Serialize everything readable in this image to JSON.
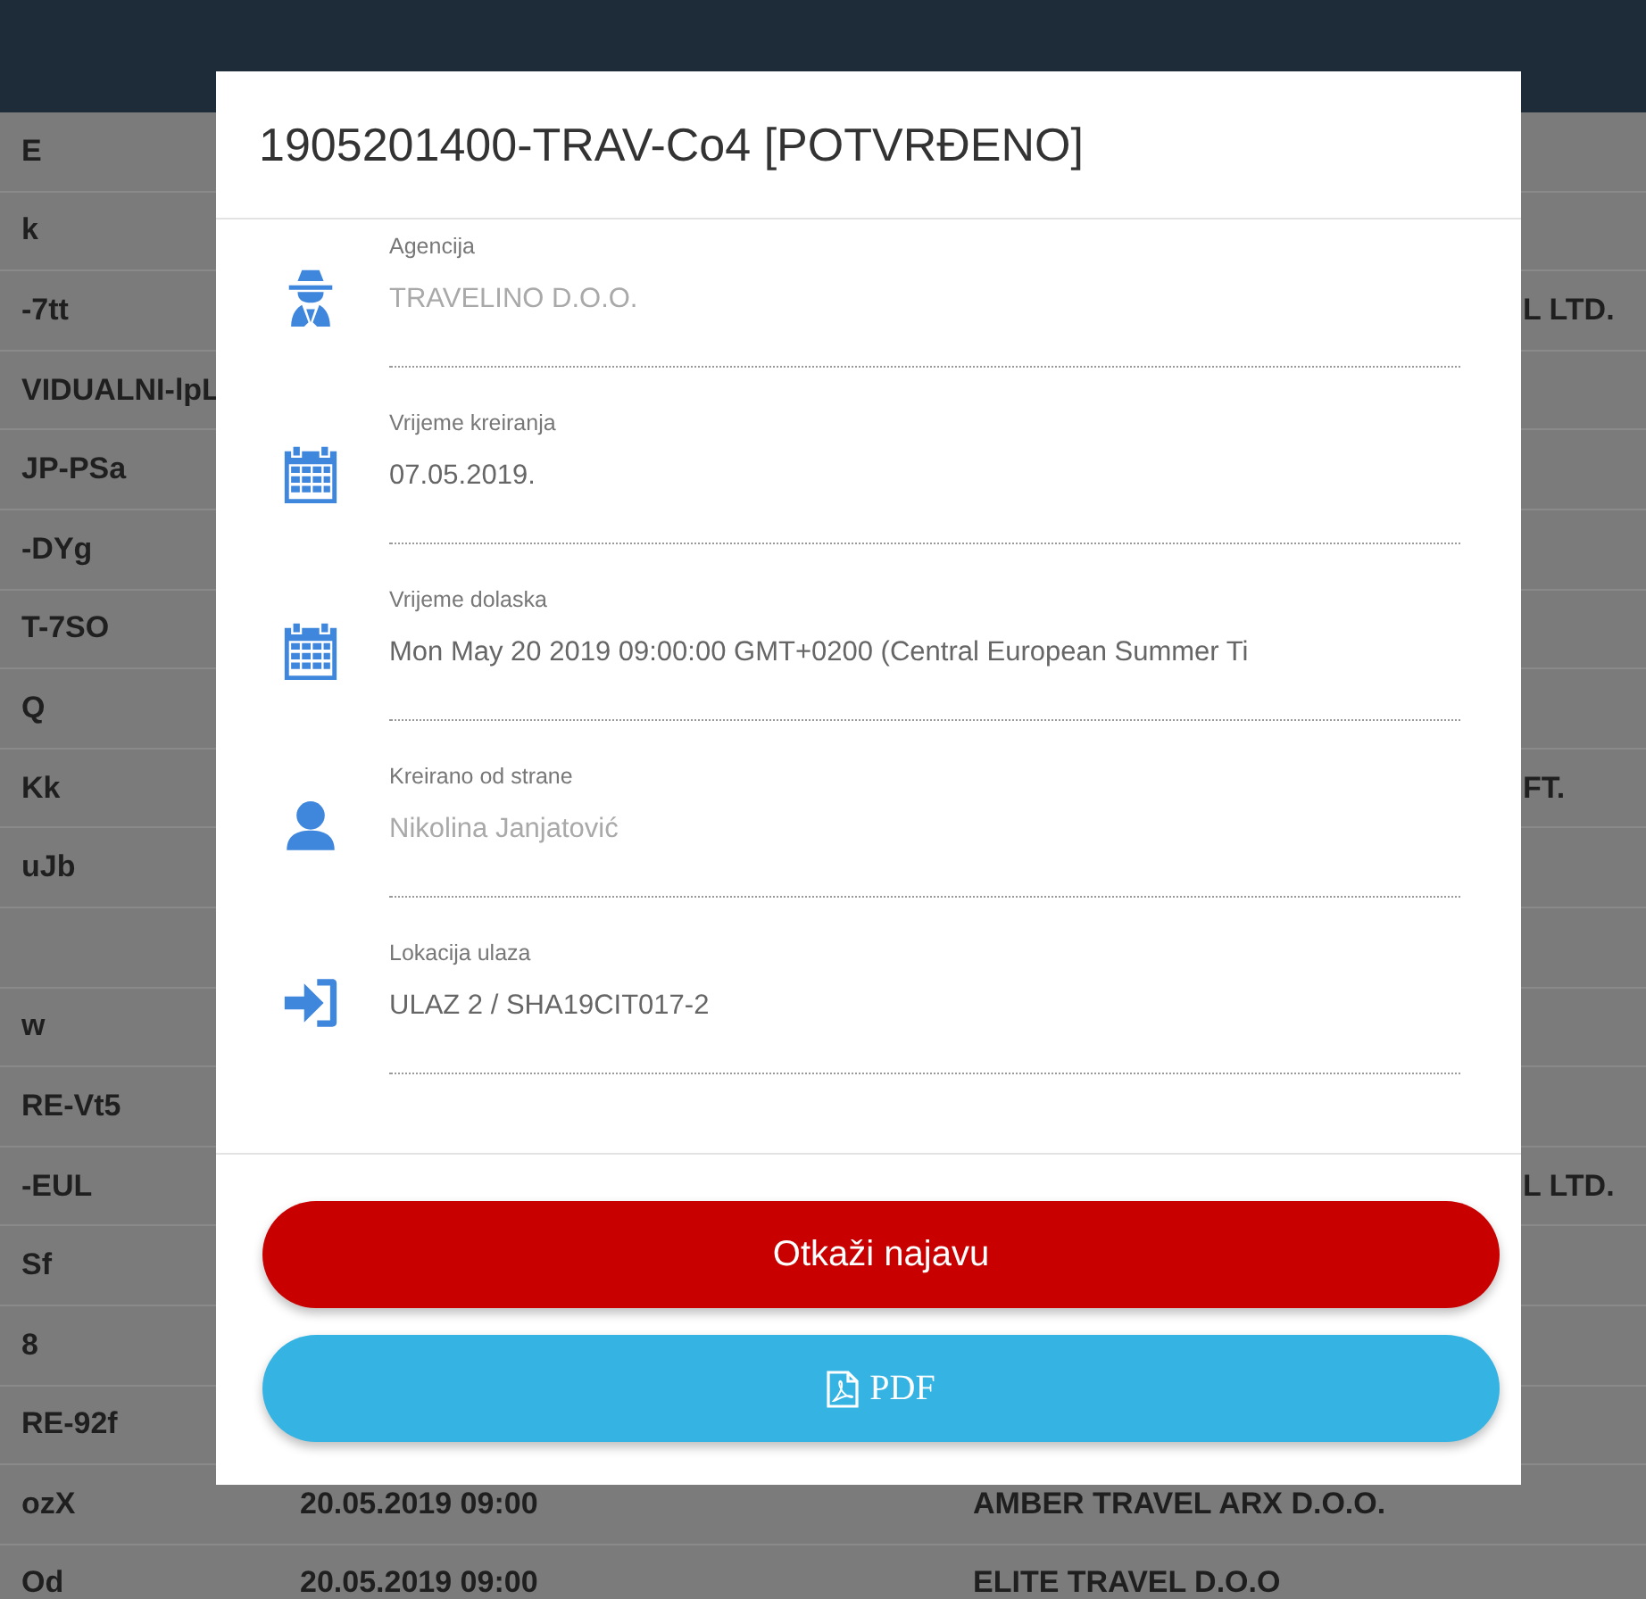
{
  "table": {
    "rows": [
      {
        "column_1": "E",
        "column_2": "",
        "column_3": ""
      },
      {
        "column_1": "k",
        "column_2": "",
        "column_3": ""
      },
      {
        "column_1": "-7tt",
        "column_2": "",
        "column_3": "L LTD."
      },
      {
        "column_1": "VIDUALNI-lpL",
        "column_2": "",
        "column_3": ""
      },
      {
        "column_1": "JP-PSa",
        "column_2": "",
        "column_3": ""
      },
      {
        "column_1": "-DYg",
        "column_2": "",
        "column_3": ""
      },
      {
        "column_1": "T-7SO",
        "column_2": "",
        "column_3": ""
      },
      {
        "column_1": "Q",
        "column_2": "",
        "column_3": ""
      },
      {
        "column_1": "Kk",
        "column_2": "",
        "column_3": "FT."
      },
      {
        "column_1": "uJb",
        "column_2": "",
        "column_3": ""
      },
      {
        "column_1": "",
        "column_2": "",
        "column_3": ""
      },
      {
        "column_1": "w",
        "column_2": "",
        "column_3": ""
      },
      {
        "column_1": "RE-Vt5",
        "column_2": "",
        "column_3": ""
      },
      {
        "column_1": "-EUL",
        "column_2": "",
        "column_3": "L LTD."
      },
      {
        "column_1": "Sf",
        "column_2": "",
        "column_3": ""
      },
      {
        "column_1": "8",
        "column_2": "",
        "column_3": ""
      },
      {
        "column_1": "RE-92f",
        "column_2": "",
        "column_3": ""
      },
      {
        "column_1": "ozX",
        "column_2": "20.05.2019 09:00",
        "column_3": "AMBER TRAVEL ARX D.O.O."
      },
      {
        "column_1": "Od",
        "column_2": "20.05.2019 09:00",
        "column_3": "ELITE TRAVEL D.O.O"
      }
    ]
  },
  "modal": {
    "title": "1905201400-TRAV-Co4 [POTVRĐENO]",
    "fields": [
      {
        "kind": "agent",
        "label": "Agencija",
        "value": "TRAVELINO D.O.O."
      },
      {
        "kind": "calendar",
        "label": "Vrijeme kreiranja",
        "value": "07.05.2019."
      },
      {
        "kind": "calendar",
        "label": "Vrijeme dolaska",
        "value": "Mon May 20 2019 09:00:00 GMT+0200 (Central European Summer Ti"
      },
      {
        "kind": "user",
        "label": "Kreirano od strane",
        "value": "Nikolina Janjatović"
      },
      {
        "kind": "login",
        "label": "Lokacija ulaza",
        "value": "ULAZ 2 / SHA19CIT017-2"
      }
    ],
    "buttons": [
      {
        "kind": "danger",
        "label": "Otkaži najavu"
      },
      {
        "kind": "pdf",
        "label": "PDF"
      }
    ]
  }
}
